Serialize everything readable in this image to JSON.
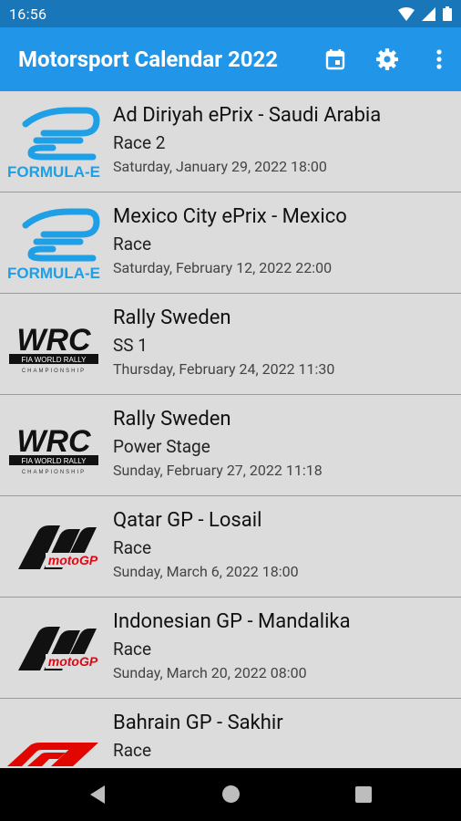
{
  "status": {
    "time": "16:56"
  },
  "app": {
    "title": "Motorsport Calendar 2022"
  },
  "logos": {
    "formula_e": "FORMULA-E",
    "wrc": "WRC",
    "wrc_sub": "FIA WORLD RALLY",
    "wrc_sub2": "CHAMPIONSHIP",
    "motogp": "motoGP"
  },
  "events": [
    {
      "series": "formula-e",
      "title": "Ad Diriyah ePrix - Saudi Arabia",
      "session": "Race 2",
      "date": "Saturday, January 29, 2022 18:00"
    },
    {
      "series": "formula-e",
      "title": "Mexico City ePrix - Mexico",
      "session": "Race",
      "date": "Saturday, February 12, 2022 22:00"
    },
    {
      "series": "wrc",
      "title": "Rally Sweden",
      "session": "SS 1",
      "date": "Thursday, February 24, 2022 11:30"
    },
    {
      "series": "wrc",
      "title": "Rally Sweden",
      "session": "Power Stage",
      "date": "Sunday, February 27, 2022 11:18"
    },
    {
      "series": "motogp",
      "title": "Qatar GP - Losail",
      "session": "Race",
      "date": "Sunday, March 6, 2022 18:00"
    },
    {
      "series": "motogp",
      "title": "Indonesian GP - Mandalika",
      "session": "Race",
      "date": "Sunday, March 20, 2022 08:00"
    },
    {
      "series": "f1",
      "title": "Bahrain GP - Sakhir",
      "session": "Race",
      "date": ""
    }
  ],
  "colors": {
    "status_bar": "#1976b8",
    "app_bar": "#2196e8",
    "formula_e": "#1e9fe6",
    "f1": "#e10600"
  }
}
